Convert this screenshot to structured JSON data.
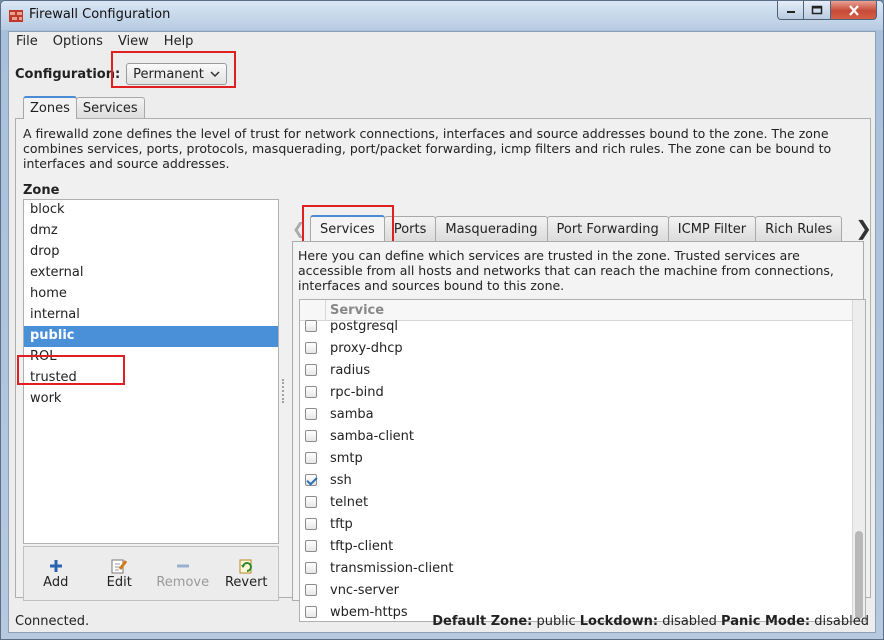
{
  "window": {
    "title": "Firewall Configuration",
    "app_icon": "firewall-icon"
  },
  "menu": [
    "File",
    "Options",
    "View",
    "Help"
  ],
  "configuration": {
    "label": "Configuration:",
    "value": "Permanent"
  },
  "main_tabs": [
    "Zones",
    "Services"
  ],
  "zones": {
    "description": "A firewalld zone defines the level of trust for network connections, interfaces and source addresses bound to the zone. The zone combines services, ports, protocols, masquerading, port/packet forwarding, icmp filters and rich rules. The zone can be bound to interfaces and source addresses.",
    "heading": "Zone",
    "items": [
      "block",
      "dmz",
      "drop",
      "external",
      "home",
      "internal",
      "public",
      "ROL",
      "trusted",
      "work"
    ],
    "selected": "public",
    "toolbar": [
      {
        "label": "Add",
        "icon": "plus-icon"
      },
      {
        "label": "Edit",
        "icon": "edit-icon"
      },
      {
        "label": "Remove",
        "icon": "minus-icon"
      },
      {
        "label": "Revert",
        "icon": "revert-icon"
      }
    ]
  },
  "zone_tabs": [
    "Services",
    "Ports",
    "Masquerading",
    "Port Forwarding",
    "ICMP Filter",
    "Rich Rules"
  ],
  "services": {
    "description": "Here you can define which services are trusted in the zone. Trusted services are accessible from all hosts and networks that can reach the machine from connections, interfaces and sources bound to this zone.",
    "column": "Service",
    "rows": [
      {
        "name": "postgresql",
        "checked": false
      },
      {
        "name": "proxy-dhcp",
        "checked": false
      },
      {
        "name": "radius",
        "checked": false
      },
      {
        "name": "rpc-bind",
        "checked": false
      },
      {
        "name": "samba",
        "checked": false
      },
      {
        "name": "samba-client",
        "checked": false
      },
      {
        "name": "smtp",
        "checked": false
      },
      {
        "name": "ssh",
        "checked": true
      },
      {
        "name": "telnet",
        "checked": false
      },
      {
        "name": "tftp",
        "checked": false
      },
      {
        "name": "tftp-client",
        "checked": false
      },
      {
        "name": "transmission-client",
        "checked": false
      },
      {
        "name": "vnc-server",
        "checked": false
      },
      {
        "name": "wbem-https",
        "checked": false
      }
    ]
  },
  "status": {
    "connection": "Connected.",
    "default_zone_label": "Default Zone:",
    "default_zone": "public",
    "lockdown_label": "Lockdown:",
    "lockdown": "disabled",
    "panic_label": "Panic Mode:",
    "panic": "disabled"
  },
  "colors": {
    "selection": "#4a90d9",
    "highlight_box": "#e02020",
    "active_tab_accent": "#4b8bd6"
  }
}
